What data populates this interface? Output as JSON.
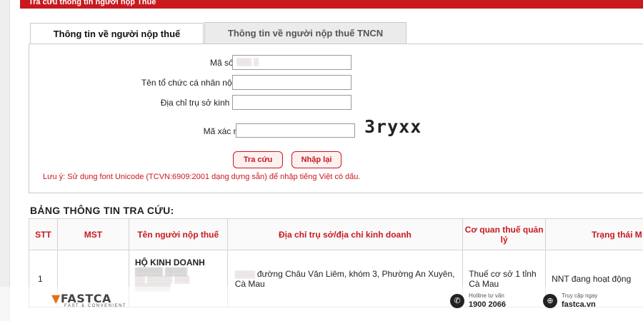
{
  "header": {
    "title": "Tra cứu thông tin người nộp Thuế"
  },
  "tabs": [
    {
      "label": "Thông tin về người nộp thuế"
    },
    {
      "label": "Thông tin về người nộp thuế TNCN"
    }
  ],
  "form": {
    "tax_code": {
      "label": "Mã số thuế",
      "required_mark": "*",
      "value": ""
    },
    "org_name": {
      "label": "Tên tổ chức cá nhân nộp thuế"
    },
    "address": {
      "label": "Địa chỉ trụ sở kinh doanh"
    },
    "captcha": {
      "label": "Mã xác nhận",
      "required_mark": "*",
      "code": "3ryxx"
    },
    "search_button": "Tra cứu",
    "reset_button": "Nhập lại",
    "note": "Lưu ý: Sử dụng font Unicode (TCVN:6909:2001 dạng dựng sẵn) để nhập tiếng Việt có dấu."
  },
  "results": {
    "title": "BẢNG THÔNG TIN TRA CỨU:",
    "columns": [
      "STT",
      "MST",
      "Tên người nộp thuế",
      "Địa chỉ trụ sở/địa chỉ kinh doanh",
      "Cơ quan thuế quản lý",
      "Trạng thái M"
    ],
    "rows": [
      {
        "stt": "1",
        "mst": "",
        "name": "HỘ KINH DOANH",
        "address": "đường Châu Văn Liêm, khóm 3, Phường An Xuyên, Cà Mau",
        "tax_office": "Thuế cơ sở 1 tỉnh Cà Mau",
        "status": "NNT đang hoạt động"
      }
    ]
  },
  "branding": {
    "logo": "FASTCA",
    "tagline": "FAST & CONVENIENT",
    "hotline_label": "Hotline tư vấn",
    "hotline": "1900 2066",
    "website_label": "Truy cập ngay",
    "website": "fastca.vn"
  },
  "colors": {
    "accent": "#c8191e",
    "brand_orange": "#e0721b"
  }
}
